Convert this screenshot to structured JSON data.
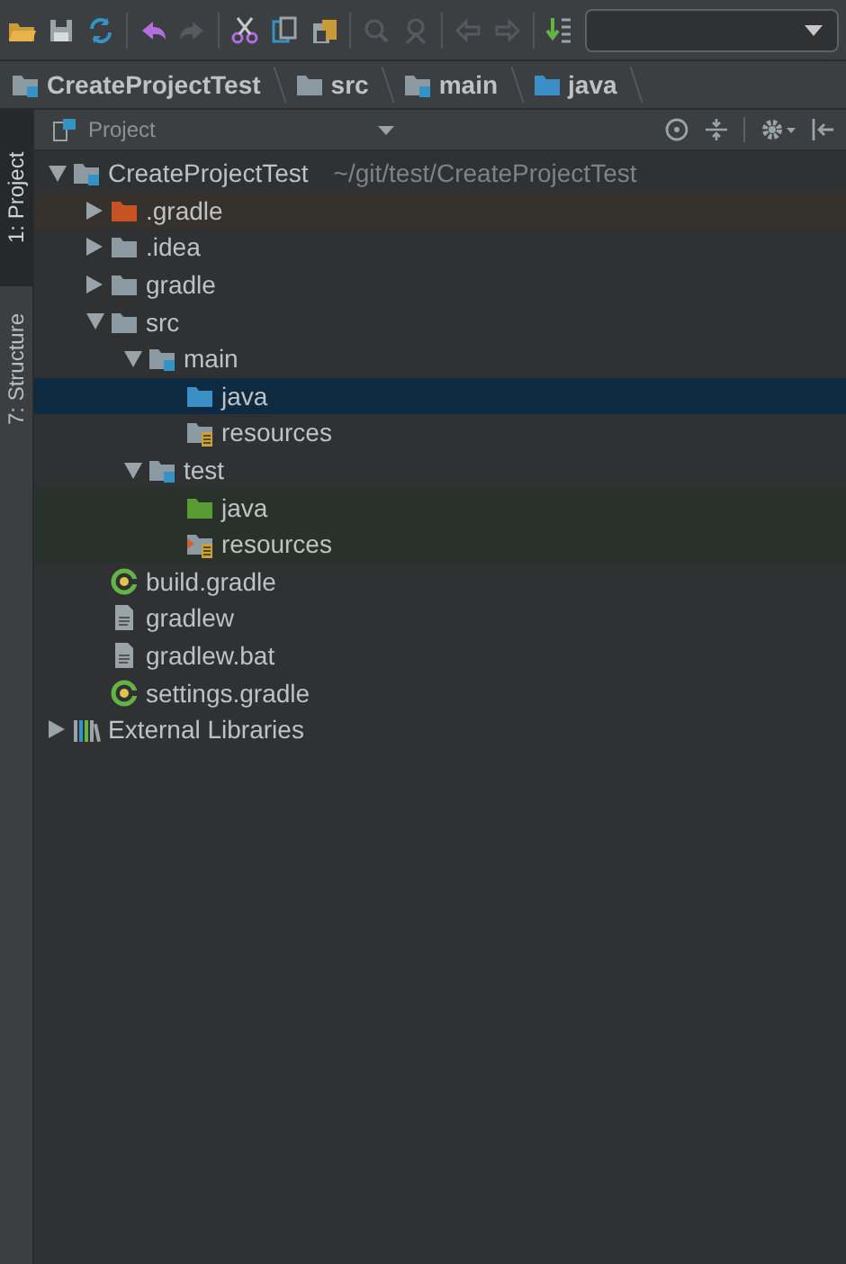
{
  "breadcrumbs": [
    {
      "label": "CreateProjectTest",
      "kind": "module"
    },
    {
      "label": "src",
      "kind": "folder"
    },
    {
      "label": "main",
      "kind": "module"
    },
    {
      "label": "java",
      "kind": "source"
    }
  ],
  "side_tabs": [
    {
      "label": "1: Project",
      "selected": true
    },
    {
      "label": "7: Structure",
      "selected": false
    }
  ],
  "panel": {
    "title": "Project"
  },
  "tree": [
    {
      "label": "CreateProjectTest",
      "path": "~/git/test/CreateProjectTest",
      "kind": "module",
      "expanded": true,
      "selected": false,
      "children": [
        {
          "label": ".gradle",
          "kind": "excluded",
          "expanded": false,
          "selected": false,
          "color": "#35322d"
        },
        {
          "label": ".idea",
          "kind": "folder",
          "expanded": false,
          "selected": false
        },
        {
          "label": "gradle",
          "kind": "folder",
          "expanded": false,
          "selected": false
        },
        {
          "label": "src",
          "kind": "folder",
          "expanded": true,
          "selected": false,
          "children": [
            {
              "label": "main",
              "kind": "module",
              "expanded": true,
              "selected": false,
              "children": [
                {
                  "label": "java",
                  "kind": "source",
                  "selected": true
                },
                {
                  "label": "resources",
                  "kind": "resources",
                  "selected": false
                }
              ]
            },
            {
              "label": "test",
              "kind": "module",
              "expanded": true,
              "selected": false,
              "children": [
                {
                  "label": "java",
                  "kind": "test-source",
                  "selected": false,
                  "color": "#28322a"
                },
                {
                  "label": "resources",
                  "kind": "test-resources",
                  "selected": false,
                  "color": "#28322a"
                }
              ]
            }
          ]
        },
        {
          "label": "build.gradle",
          "kind": "gradle",
          "selected": false
        },
        {
          "label": "gradlew",
          "kind": "text",
          "selected": false
        },
        {
          "label": "gradlew.bat",
          "kind": "text",
          "selected": false
        },
        {
          "label": "settings.gradle",
          "kind": "gradle",
          "selected": false
        }
      ]
    },
    {
      "label": "External Libraries",
      "kind": "libraries",
      "expanded": false,
      "selected": false
    }
  ]
}
